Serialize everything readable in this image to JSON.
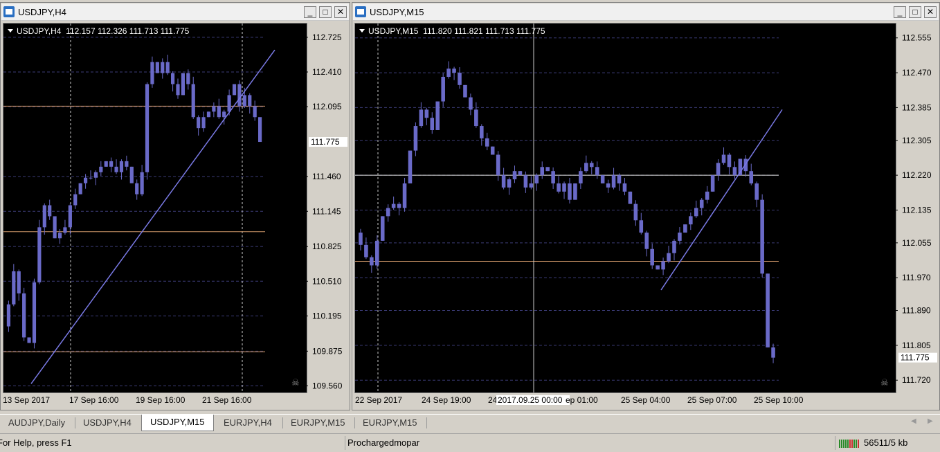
{
  "windows": [
    {
      "title": "USDJPY,H4",
      "info_symbol": "USDJPY,H4",
      "info_ohlc": "112.157 112.326 111.713 111.775",
      "price_labels": [
        "112.725",
        "112.410",
        "112.095",
        "111.775",
        "111.460",
        "111.145",
        "110.825",
        "110.510",
        "110.195",
        "109.875",
        "109.560"
      ],
      "current_price": "111.775",
      "time_labels": [
        "13 Sep 2017",
        "17 Sep 16:00",
        "19 Sep 16:00",
        "21 Sep 16:00"
      ]
    },
    {
      "title": "USDJPY,M15",
      "info_symbol": "USDJPY,M15",
      "info_ohlc": "111.820 111.821 111.713 111.775",
      "price_labels": [
        "112.555",
        "112.470",
        "112.385",
        "112.305",
        "112.220",
        "112.135",
        "112.055",
        "111.970",
        "111.890",
        "111.805",
        "111.775",
        "111.720"
      ],
      "current_price": "111.775",
      "time_labels": [
        "22 Sep 2017",
        "24 Sep 19:00",
        "24",
        "2017.09.25 00:00",
        "ep 01:00",
        "25 Sep 04:00",
        "25 Sep 07:00",
        "25 Sep 10:00"
      ]
    }
  ],
  "window_buttons": {
    "minimize": "_",
    "maximize": "□",
    "close": "✕"
  },
  "tabs": [
    "AUDJPY,Daily",
    "USDJPY,H4",
    "USDJPY,M15",
    "EURJPY,H4",
    "EURJPY,M15",
    "EURJPY,M15"
  ],
  "active_tab": "USDJPY,M15",
  "status": {
    "help": "For Help, press F1",
    "profile": "Prochargedmopar",
    "traffic": "56511/5 kb"
  },
  "colors": {
    "candle": "#6a6ac8",
    "grid": "#3c3c78",
    "hline": "#d49a6a",
    "trend": "#7a7ae6",
    "hline_white": "#e6e6e6"
  },
  "chart_data": [
    {
      "type": "candlestick",
      "symbol": "USDJPY",
      "timeframe": "H4",
      "ylim": [
        109.5,
        112.85
      ],
      "horizontal_lines": [
        112.1,
        110.96,
        109.87
      ],
      "current": 111.775
    },
    {
      "type": "candlestick",
      "symbol": "USDJPY",
      "timeframe": "M15",
      "ylim": [
        111.69,
        112.59
      ],
      "horizontal_lines": [
        112.22,
        112.01
      ],
      "current": 111.775
    }
  ]
}
